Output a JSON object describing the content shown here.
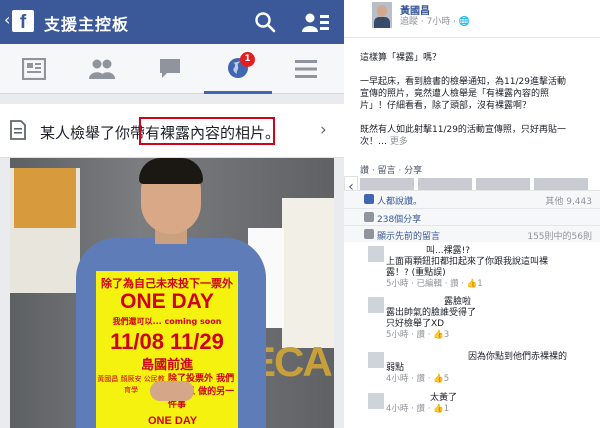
{
  "left_phone": {
    "header": {
      "back_glyph": "‹",
      "logo_letter": "f",
      "title": "支援主控板",
      "icons": [
        "search-icon",
        "friends-icon"
      ]
    },
    "tabs": [
      {
        "icon": "news-feed-icon"
      },
      {
        "icon": "friend-requests-icon"
      },
      {
        "icon": "messages-icon"
      },
      {
        "icon": "notifications-globe-icon",
        "badge": "1",
        "active": true
      },
      {
        "icon": "menu-icon"
      }
    ],
    "notification": {
      "text": "某人檢舉了你帶有裸露內容的相片。",
      "chevron": "›",
      "highlight_color": "#d0021b"
    },
    "photo": {
      "sign_line1": "除了為自己未來投下一票外",
      "sign_line2": "ONE DAY",
      "sign_line3": "我們還可以... coming soon",
      "sign_line4": "11/08 11/29",
      "sign_line5": "島國前進",
      "sign_line6": "除了投票外 我們還可以 做的另一件事",
      "sign_line7": "黃國昌 顏厥安 公民教育學",
      "sign_line8": "ONE DAY",
      "wall_text": "ECA"
    }
  },
  "right_phone": {
    "author": {
      "name": "黃國昌",
      "meta": "追蹤 · 7小時 · 🌐"
    },
    "post_lines": [
      "這樣算「裸露」嗎？",
      "",
      "一早起床，看到臉書的檢舉通知，為11/29進擊活動",
      "宣傳的照片，竟然遭人檢舉是「有裸露內容的照",
      "片」！仔細看看，除了頭部，沒有裸露啊？",
      "",
      "既然有人如此射擊11/29的活動宣傳照，只好再貼一",
      "次！…"
    ],
    "more_label": "更多",
    "action_bar": "讚 · 留言 · 分享",
    "arrow": "‹",
    "likes": {
      "label": "人都說讚。",
      "others": "其他 9,443"
    },
    "shares": {
      "label": "238個分享"
    },
    "prev_comments": {
      "label": "顯示先前的留言",
      "count": "155則中的56則"
    },
    "comments": [
      {
        "name": "",
        "text": "上面兩顆鈕扣都扣起來了你跟我說這叫裸",
        "text2": "露！? (重點誤)",
        "first": "叫...裸露!?",
        "meta": "5小時 · 已編輯 · 讚 · 👍1"
      },
      {
        "name": "",
        "first": "露臉啦",
        "text": "露出帥氣的臉誰受得了",
        "text2": "只好檢舉了XD",
        "meta": "5小時 · 讚 · 👍3"
      },
      {
        "name": "",
        "first": "因為你點到他們赤裸裸的",
        "text": "弱點",
        "text2": "",
        "meta": "4小時 · 讚 · 👍5"
      },
      {
        "name": "",
        "first": "太黃了",
        "text": "",
        "text2": "",
        "meta": "4小時 · 讚 · 👍1"
      }
    ]
  },
  "colors": {
    "fb_blue": "#3b5998",
    "highlight_red": "#d0021b",
    "sign_yellow": "#f4f20e"
  }
}
